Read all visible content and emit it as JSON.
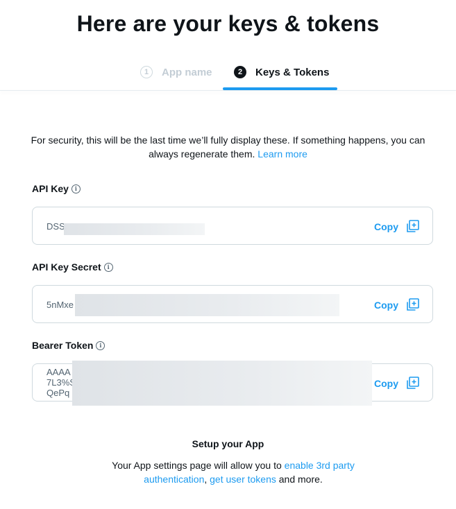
{
  "page": {
    "title": "Here are your keys & tokens"
  },
  "steps": [
    {
      "number": "1",
      "label": "App name",
      "active": false
    },
    {
      "number": "2",
      "label": "Keys & Tokens",
      "active": true
    }
  ],
  "notice": {
    "text": "For security, this will be the last time we’ll fully display these. If something happens, you can always regenerate them.",
    "link": "Learn more"
  },
  "fields": {
    "api_key": {
      "label": "API Key",
      "value": "DSS",
      "copy_label": "Copy"
    },
    "api_key_secret": {
      "label": "API Key Secret",
      "value": "5nMxe",
      "copy_label": "Copy"
    },
    "bearer_token": {
      "label": "Bearer Token",
      "value_lines": [
        "AAAA",
        "7L3%S",
        "QePq"
      ],
      "copy_label": "Copy"
    }
  },
  "setup": {
    "title": "Setup your App",
    "text_before": "Your App settings page will allow you to ",
    "link1": "enable 3rd party authentication",
    "sep": ", ",
    "link2": "get user tokens",
    "text_after": " and more."
  },
  "colors": {
    "accent": "#1d9bf0",
    "text": "#0f1419",
    "muted": "#536471",
    "border": "#cfd9de"
  },
  "icons": {
    "info": "info-circle-icon",
    "copy": "copy-add-icon"
  }
}
